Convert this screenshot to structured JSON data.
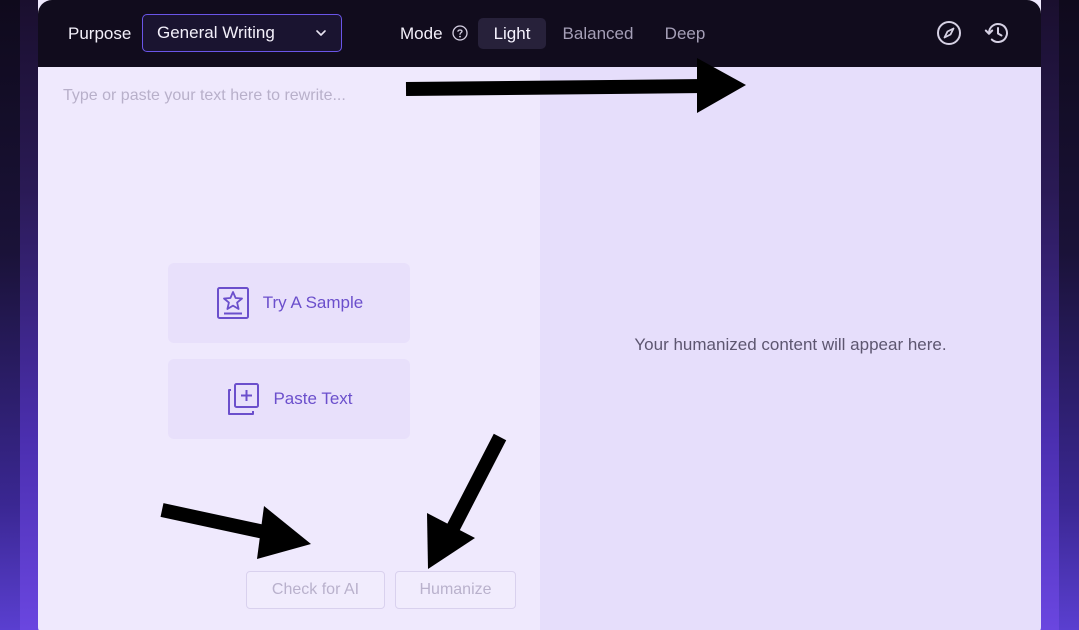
{
  "toolbar": {
    "purpose_label": "Purpose",
    "purpose_selected": "General Writing",
    "mode_label": "Mode",
    "modes": [
      "Light",
      "Balanced",
      "Deep"
    ],
    "active_mode": "Light",
    "icons": [
      "compass-icon",
      "history-icon"
    ]
  },
  "editor": {
    "placeholder": "Type or paste your text here to rewrite...",
    "sample_button": "Try A Sample",
    "paste_button": "Paste Text",
    "check_ai_button": "Check for AI",
    "humanize_button": "Humanize"
  },
  "output": {
    "empty_message": "Your humanized content will appear here."
  },
  "colors": {
    "accent": "#6b4fcc",
    "toolbar_bg": "#110c1d",
    "input_bg": "#efe9fd",
    "output_bg": "#e6defb"
  }
}
